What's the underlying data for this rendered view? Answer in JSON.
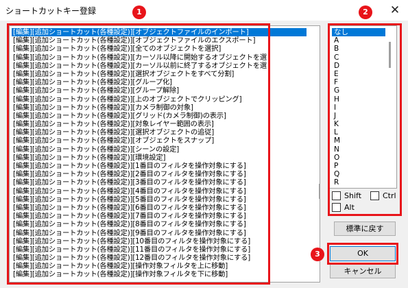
{
  "window": {
    "title": "ショートカットキー登録",
    "close_glyph": "✕"
  },
  "list": {
    "items": [
      "[編集][追加ショートカット(各種設定)][オブジェクトファイルのインポート]",
      "[編集][追加ショートカット(各種設定)][オブジェクトファイルのエクスポート]",
      "[編集][追加ショートカット(各種設定)][全てのオブジェクトを選択]",
      "[編集][追加ショートカット(各種設定)][カーソル以降に開始するオブジェクトを選",
      "[編集][追加ショートカット(各種設定)][カーソル以前に終了するオブジェクトを選",
      "[編集][追加ショートカット(各種設定)][選択オブジェクトをすべて分割]",
      "[編集][追加ショートカット(各種設定)][グループ化]",
      "[編集][追加ショートカット(各種設定)][グループ解除]",
      "[編集][追加ショートカット(各種設定)][上のオブジェクトでクリッピング]",
      "[編集][追加ショートカット(各種設定)][カメラ制御の対象]",
      "[編集][追加ショートカット(各種設定)][グリッド(カメラ制御)の表示]",
      "[編集][追加ショートカット(各種設定)][対象レイヤー範囲の表示]",
      "[編集][追加ショートカット(各種設定)][選択オブジェクトの追従]",
      "[編集][追加ショートカット(各種設定)][オブジェクトをスナップ]",
      "[編集][追加ショートカット(各種設定)][シーンの設定]",
      "[編集][追加ショートカット(各種設定)][環境設定]",
      "[編集][追加ショートカット(各種設定)][1番目のフィルタを操作対象にする]",
      "[編集][追加ショートカット(各種設定)][2番目のフィルタを操作対象にする]",
      "[編集][追加ショートカット(各種設定)][3番目のフィルタを操作対象にする]",
      "[編集][追加ショートカット(各種設定)][4番目のフィルタを操作対象にする]",
      "[編集][追加ショートカット(各種設定)][5番目のフィルタを操作対象にする]",
      "[編集][追加ショートカット(各種設定)][6番目のフィルタを操作対象にする]",
      "[編集][追加ショートカット(各種設定)][7番目のフィルタを操作対象にする]",
      "[編集][追加ショートカット(各種設定)][8番目のフィルタを操作対象にする]",
      "[編集][追加ショートカット(各種設定)][9番目のフィルタを操作対象にする]",
      "[編集][追加ショートカット(各種設定)][10番目のフィルタを操作対象にする]",
      "[編集][追加ショートカット(各種設定)][11番目のフィルタを操作対象にする]",
      "[編集][追加ショートカット(各種設定)][12番目のフィルタを操作対象にする]",
      "[編集][追加ショートカット(各種設定)][操作対象フィルタを上に移動]",
      "[編集][追加ショートカット(各種設定)][操作対象フィルタを下に移動]"
    ]
  },
  "keys": {
    "items": [
      "なし",
      "A",
      "B",
      "C",
      "D",
      "E",
      "F",
      "G",
      "H",
      "I",
      "J",
      "K",
      "L",
      "M",
      "N",
      "O",
      "P",
      "Q",
      "R"
    ]
  },
  "modifiers": {
    "shift": "Shift",
    "ctrl": "Ctrl",
    "alt": "Alt"
  },
  "buttons": {
    "reset": "標準に戻す",
    "ok": "OK",
    "cancel": "キャンセル"
  },
  "badges": {
    "b1": "1",
    "b2": "2",
    "b3": "3"
  },
  "colors": {
    "selection": "#0078d7",
    "highlight": "#e8141a"
  }
}
